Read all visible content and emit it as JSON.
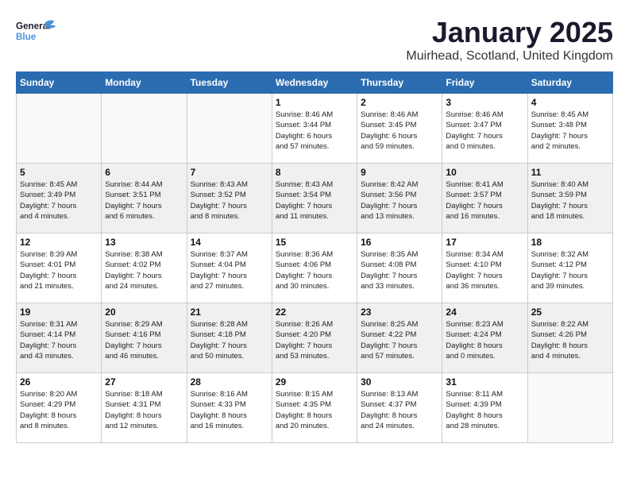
{
  "header": {
    "logo_general": "General",
    "logo_blue": "Blue",
    "title": "January 2025",
    "subtitle": "Muirhead, Scotland, United Kingdom"
  },
  "days_of_week": [
    "Sunday",
    "Monday",
    "Tuesday",
    "Wednesday",
    "Thursday",
    "Friday",
    "Saturday"
  ],
  "weeks": [
    [
      {
        "day": "",
        "info": "",
        "shaded": false,
        "empty": true
      },
      {
        "day": "",
        "info": "",
        "shaded": false,
        "empty": true
      },
      {
        "day": "",
        "info": "",
        "shaded": false,
        "empty": true
      },
      {
        "day": "1",
        "info": "Sunrise: 8:46 AM\nSunset: 3:44 PM\nDaylight: 6 hours\nand 57 minutes.",
        "shaded": false,
        "empty": false
      },
      {
        "day": "2",
        "info": "Sunrise: 8:46 AM\nSunset: 3:45 PM\nDaylight: 6 hours\nand 59 minutes.",
        "shaded": false,
        "empty": false
      },
      {
        "day": "3",
        "info": "Sunrise: 8:46 AM\nSunset: 3:47 PM\nDaylight: 7 hours\nand 0 minutes.",
        "shaded": false,
        "empty": false
      },
      {
        "day": "4",
        "info": "Sunrise: 8:45 AM\nSunset: 3:48 PM\nDaylight: 7 hours\nand 2 minutes.",
        "shaded": false,
        "empty": false
      }
    ],
    [
      {
        "day": "5",
        "info": "Sunrise: 8:45 AM\nSunset: 3:49 PM\nDaylight: 7 hours\nand 4 minutes.",
        "shaded": true,
        "empty": false
      },
      {
        "day": "6",
        "info": "Sunrise: 8:44 AM\nSunset: 3:51 PM\nDaylight: 7 hours\nand 6 minutes.",
        "shaded": true,
        "empty": false
      },
      {
        "day": "7",
        "info": "Sunrise: 8:43 AM\nSunset: 3:52 PM\nDaylight: 7 hours\nand 8 minutes.",
        "shaded": true,
        "empty": false
      },
      {
        "day": "8",
        "info": "Sunrise: 8:43 AM\nSunset: 3:54 PM\nDaylight: 7 hours\nand 11 minutes.",
        "shaded": true,
        "empty": false
      },
      {
        "day": "9",
        "info": "Sunrise: 8:42 AM\nSunset: 3:56 PM\nDaylight: 7 hours\nand 13 minutes.",
        "shaded": true,
        "empty": false
      },
      {
        "day": "10",
        "info": "Sunrise: 8:41 AM\nSunset: 3:57 PM\nDaylight: 7 hours\nand 16 minutes.",
        "shaded": true,
        "empty": false
      },
      {
        "day": "11",
        "info": "Sunrise: 8:40 AM\nSunset: 3:59 PM\nDaylight: 7 hours\nand 18 minutes.",
        "shaded": true,
        "empty": false
      }
    ],
    [
      {
        "day": "12",
        "info": "Sunrise: 8:39 AM\nSunset: 4:01 PM\nDaylight: 7 hours\nand 21 minutes.",
        "shaded": false,
        "empty": false
      },
      {
        "day": "13",
        "info": "Sunrise: 8:38 AM\nSunset: 4:02 PM\nDaylight: 7 hours\nand 24 minutes.",
        "shaded": false,
        "empty": false
      },
      {
        "day": "14",
        "info": "Sunrise: 8:37 AM\nSunset: 4:04 PM\nDaylight: 7 hours\nand 27 minutes.",
        "shaded": false,
        "empty": false
      },
      {
        "day": "15",
        "info": "Sunrise: 8:36 AM\nSunset: 4:06 PM\nDaylight: 7 hours\nand 30 minutes.",
        "shaded": false,
        "empty": false
      },
      {
        "day": "16",
        "info": "Sunrise: 8:35 AM\nSunset: 4:08 PM\nDaylight: 7 hours\nand 33 minutes.",
        "shaded": false,
        "empty": false
      },
      {
        "day": "17",
        "info": "Sunrise: 8:34 AM\nSunset: 4:10 PM\nDaylight: 7 hours\nand 36 minutes.",
        "shaded": false,
        "empty": false
      },
      {
        "day": "18",
        "info": "Sunrise: 8:32 AM\nSunset: 4:12 PM\nDaylight: 7 hours\nand 39 minutes.",
        "shaded": false,
        "empty": false
      }
    ],
    [
      {
        "day": "19",
        "info": "Sunrise: 8:31 AM\nSunset: 4:14 PM\nDaylight: 7 hours\nand 43 minutes.",
        "shaded": true,
        "empty": false
      },
      {
        "day": "20",
        "info": "Sunrise: 8:29 AM\nSunset: 4:16 PM\nDaylight: 7 hours\nand 46 minutes.",
        "shaded": true,
        "empty": false
      },
      {
        "day": "21",
        "info": "Sunrise: 8:28 AM\nSunset: 4:18 PM\nDaylight: 7 hours\nand 50 minutes.",
        "shaded": true,
        "empty": false
      },
      {
        "day": "22",
        "info": "Sunrise: 8:26 AM\nSunset: 4:20 PM\nDaylight: 7 hours\nand 53 minutes.",
        "shaded": true,
        "empty": false
      },
      {
        "day": "23",
        "info": "Sunrise: 8:25 AM\nSunset: 4:22 PM\nDaylight: 7 hours\nand 57 minutes.",
        "shaded": true,
        "empty": false
      },
      {
        "day": "24",
        "info": "Sunrise: 8:23 AM\nSunset: 4:24 PM\nDaylight: 8 hours\nand 0 minutes.",
        "shaded": true,
        "empty": false
      },
      {
        "day": "25",
        "info": "Sunrise: 8:22 AM\nSunset: 4:26 PM\nDaylight: 8 hours\nand 4 minutes.",
        "shaded": true,
        "empty": false
      }
    ],
    [
      {
        "day": "26",
        "info": "Sunrise: 8:20 AM\nSunset: 4:29 PM\nDaylight: 8 hours\nand 8 minutes.",
        "shaded": false,
        "empty": false
      },
      {
        "day": "27",
        "info": "Sunrise: 8:18 AM\nSunset: 4:31 PM\nDaylight: 8 hours\nand 12 minutes.",
        "shaded": false,
        "empty": false
      },
      {
        "day": "28",
        "info": "Sunrise: 8:16 AM\nSunset: 4:33 PM\nDaylight: 8 hours\nand 16 minutes.",
        "shaded": false,
        "empty": false
      },
      {
        "day": "29",
        "info": "Sunrise: 8:15 AM\nSunset: 4:35 PM\nDaylight: 8 hours\nand 20 minutes.",
        "shaded": false,
        "empty": false
      },
      {
        "day": "30",
        "info": "Sunrise: 8:13 AM\nSunset: 4:37 PM\nDaylight: 8 hours\nand 24 minutes.",
        "shaded": false,
        "empty": false
      },
      {
        "day": "31",
        "info": "Sunrise: 8:11 AM\nSunset: 4:39 PM\nDaylight: 8 hours\nand 28 minutes.",
        "shaded": false,
        "empty": false
      },
      {
        "day": "",
        "info": "",
        "shaded": false,
        "empty": true
      }
    ]
  ]
}
